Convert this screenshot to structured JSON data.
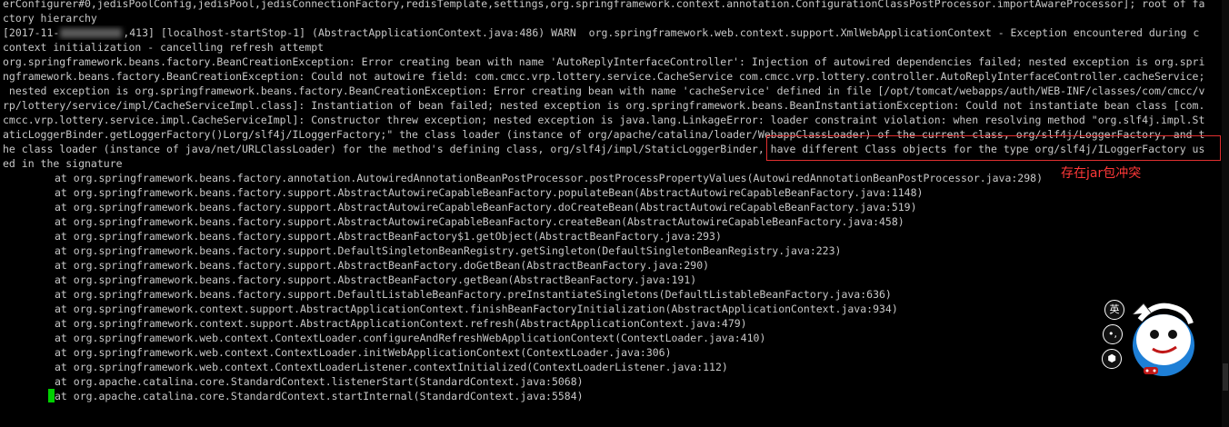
{
  "terminal": {
    "lines": [
      "erConfigurer#0,jedisPoolConfig,jedisPool,jedisConnectionFactory,redisTemplate,settings,org.springframework.context.annotation.ConfigurationClassPostProcessor.importAwareProcessor]; root of fa",
      "ctory hierarchy",
      "",
      "context initialization - cancelling refresh attempt",
      "org.springframework.beans.factory.BeanCreationException: Error creating bean with name 'AutoReplyInterfaceController': Injection of autowired dependencies failed; nested exception is org.spri",
      "ngframework.beans.factory.BeanCreationException: Could not autowire field: com.cmcc.vrp.lottery.service.CacheService com.cmcc.vrp.lottery.controller.AutoReplyInterfaceController.cacheService;",
      " nested exception is org.springframework.beans.factory.BeanCreationException: Error creating bean with name 'cacheService' defined in file [/opt/tomcat/webapps/auth/WEB-INF/classes/com/cmcc/v",
      "rp/lottery/service/impl/CacheServiceImpl.class]: Instantiation of bean failed; nested exception is org.springframework.beans.BeanInstantiationException: Could not instantiate bean class [com.",
      "cmcc.vrp.lottery.service.impl.CacheServiceImpl]: Constructor threw exception; nested exception is java.lang.LinkageError: loader constraint violation: when resolving method \"org.slf4j.impl.St",
      "aticLoggerBinder.getLoggerFactory()Lorg/slf4j/ILoggerFactory;\" the class loader (instance of org/apache/catalina/loader/WebappClassLoader) of the current class, org/slf4j/LoggerFactory, and t",
      "he class loader (instance of java/net/URLClassLoader) for the method's defining class, org/slf4j/impl/StaticLoggerBinder, have different Class objects for the type org/slf4j/ILoggerFactory us",
      "ed in the signature"
    ],
    "warn_line": {
      "prefix": "[2017-11-",
      "suffix": ",413] [localhost-startStop-1] (AbstractApplicationContext.java:486) WARN  org.springframework.web.context.support.XmlWebApplicationContext - Exception encountered during c"
    },
    "stack_trace": [
      "at org.springframework.beans.factory.annotation.AutowiredAnnotationBeanPostProcessor.postProcessPropertyValues(AutowiredAnnotationBeanPostProcessor.java:298)",
      "at org.springframework.beans.factory.support.AbstractAutowireCapableBeanFactory.populateBean(AbstractAutowireCapableBeanFactory.java:1148)",
      "at org.springframework.beans.factory.support.AbstractAutowireCapableBeanFactory.doCreateBean(AbstractAutowireCapableBeanFactory.java:519)",
      "at org.springframework.beans.factory.support.AbstractAutowireCapableBeanFactory.createBean(AbstractAutowireCapableBeanFactory.java:458)",
      "at org.springframework.beans.factory.support.AbstractBeanFactory$1.getObject(AbstractBeanFactory.java:293)",
      "at org.springframework.beans.factory.support.DefaultSingletonBeanRegistry.getSingleton(DefaultSingletonBeanRegistry.java:223)",
      "at org.springframework.beans.factory.support.AbstractBeanFactory.doGetBean(AbstractBeanFactory.java:290)",
      "at org.springframework.beans.factory.support.AbstractBeanFactory.getBean(AbstractBeanFactory.java:191)",
      "at org.springframework.beans.factory.support.DefaultListableBeanFactory.preInstantiateSingletons(DefaultListableBeanFactory.java:636)",
      "at org.springframework.context.support.AbstractApplicationContext.finishBeanFactoryInitialization(AbstractApplicationContext.java:934)",
      "at org.springframework.context.support.AbstractApplicationContext.refresh(AbstractApplicationContext.java:479)",
      "at org.springframework.web.context.ContextLoader.configureAndRefreshWebApplicationContext(ContextLoader.java:410)",
      "at org.springframework.web.context.ContextLoader.initWebApplicationContext(ContextLoader.java:306)",
      "at org.springframework.web.context.ContextLoaderListener.contextInitialized(ContextLoaderListener.java:112)",
      "at org.apache.catalina.core.StandardContext.listenerStart(StandardContext.java:5068)",
      "at org.apache.catalina.core.StandardContext.startInternal(StandardContext.java:5584)"
    ]
  },
  "annotation": {
    "text": "存在jar包冲突",
    "color": "#ff3838"
  },
  "widget": {
    "buttons": [
      "英",
      "•,",
      "⬢"
    ]
  },
  "colors": {
    "background": "#000000",
    "text": "#c8c8c8",
    "cursor": "#00d000",
    "highlight_border": "#e03030"
  }
}
